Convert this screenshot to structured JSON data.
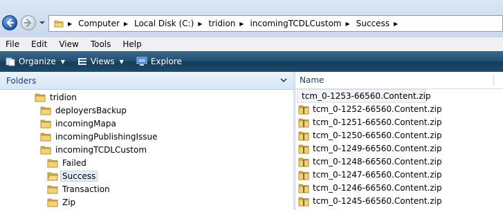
{
  "address": {
    "crumbs": [
      "Computer",
      "Local Disk (C:)",
      "tridion",
      "incomingTCDLCustom",
      "Success"
    ]
  },
  "menu": [
    "File",
    "Edit",
    "View",
    "Tools",
    "Help"
  ],
  "toolbar": {
    "organize": "Organize",
    "views": "Views",
    "explore": "Explore"
  },
  "folders_pane": {
    "title": "Folders",
    "tree": [
      {
        "label": "tridion",
        "level": 0
      },
      {
        "label": "deployersBackup",
        "level": 1
      },
      {
        "label": "incomingMapa",
        "level": 1
      },
      {
        "label": "incomingPublishingIssue",
        "level": 1
      },
      {
        "label": "incomingTCDLCustom",
        "level": 1
      },
      {
        "label": "Failed",
        "level": 2
      },
      {
        "label": "Success",
        "level": 2,
        "selected": true
      },
      {
        "label": "Transaction",
        "level": 2
      },
      {
        "label": "Zip",
        "level": 2
      }
    ]
  },
  "file_list": {
    "column_name": "Name",
    "files": [
      "tcm_0-1253-66560.Content.zip",
      "tcm_0-1252-66560.Content.zip",
      "tcm_0-1251-66560.Content.zip",
      "tcm_0-1250-66560.Content.zip",
      "tcm_0-1249-66560.Content.zip",
      "tcm_0-1248-66560.Content.zip",
      "tcm_0-1247-66560.Content.zip",
      "tcm_0-1246-66560.Content.zip",
      "tcm_0-1245-66560.Content.zip"
    ]
  },
  "colors": {
    "toolbar": "#1f4d6f",
    "folder": "#e8c25a",
    "selection": "#e3ebf6"
  }
}
